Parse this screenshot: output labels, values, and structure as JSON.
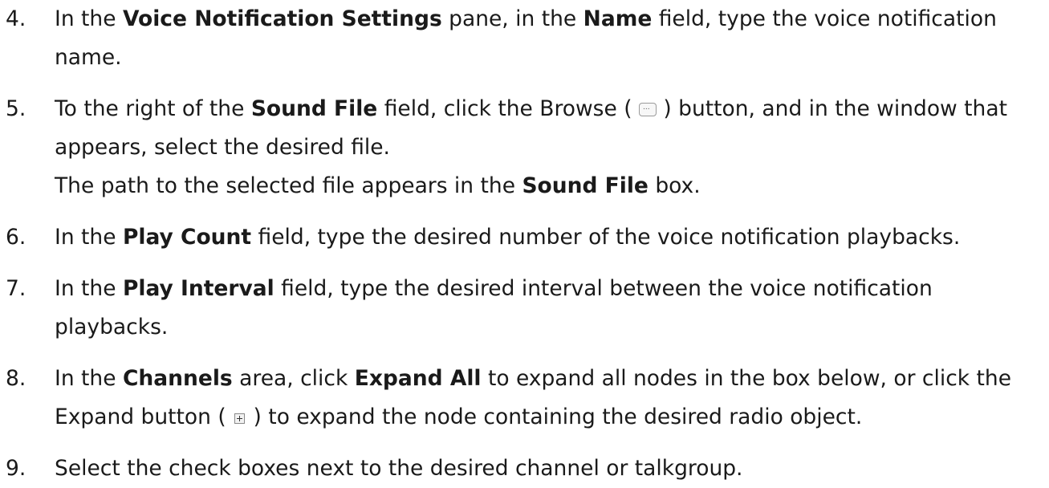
{
  "steps": [
    {
      "num": "4.",
      "lines": [
        [
          {
            "t": "In the "
          },
          {
            "t": "Voice Notification Settings",
            "b": true
          },
          {
            "t": " pane, in the "
          },
          {
            "t": "Name",
            "b": true
          },
          {
            "t": " field, type the voice notification"
          }
        ],
        [
          {
            "t": "name."
          }
        ]
      ]
    },
    {
      "num": "5.",
      "lines": [
        [
          {
            "t": "To the right of the "
          },
          {
            "t": "Sound File",
            "b": true
          },
          {
            "t": " field, click the Browse ( "
          },
          {
            "icon": "browse-icon"
          },
          {
            "t": " ) button, and in the window that"
          }
        ],
        [
          {
            "t": "appears, select the desired file."
          }
        ],
        [
          {
            "t": "The path to the selected file appears in the "
          },
          {
            "t": "Sound File",
            "b": true
          },
          {
            "t": " box."
          }
        ]
      ]
    },
    {
      "num": "6.",
      "lines": [
        [
          {
            "t": "In the "
          },
          {
            "t": "Play Count",
            "b": true
          },
          {
            "t": " field, type the desired number of the voice notification playbacks."
          }
        ]
      ]
    },
    {
      "num": "7.",
      "lines": [
        [
          {
            "t": "In the "
          },
          {
            "t": "Play Interval",
            "b": true
          },
          {
            "t": " field, type the desired interval between the voice notification"
          }
        ],
        [
          {
            "t": "playbacks."
          }
        ]
      ]
    },
    {
      "num": "8.",
      "lines": [
        [
          {
            "t": "In the "
          },
          {
            "t": "Channels",
            "b": true
          },
          {
            "t": " area, click "
          },
          {
            "t": "Expand All",
            "b": true
          },
          {
            "t": " to expand all nodes in the box below, or click the"
          }
        ],
        [
          {
            "t": "Expand button ( "
          },
          {
            "icon": "expand-icon"
          },
          {
            "t": " ) to expand the node containing the desired radio object."
          }
        ]
      ]
    },
    {
      "num": "9.",
      "lines": [
        [
          {
            "t": "Select the check boxes next to the desired channel or talkgroup."
          }
        ]
      ]
    }
  ]
}
